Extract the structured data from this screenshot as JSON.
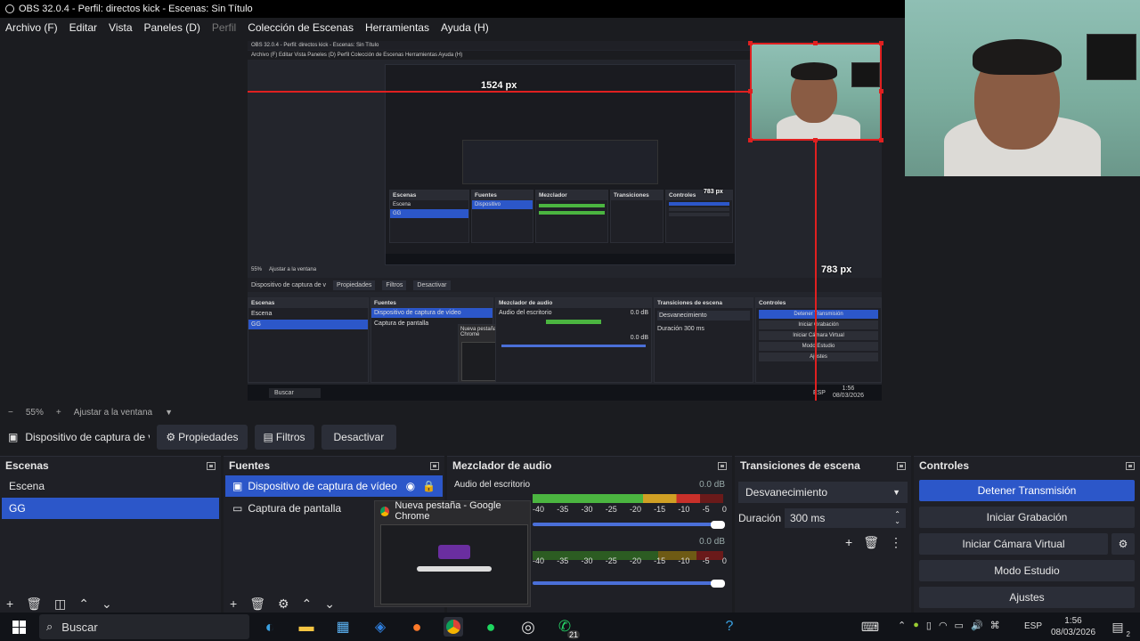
{
  "window": {
    "title": "OBS 32.0.4 - Perfil: directos kick - Escenas: Sin Título"
  },
  "menu": [
    {
      "label": "Archivo (F)",
      "disabled": false
    },
    {
      "label": "Editar",
      "disabled": false
    },
    {
      "label": "Vista",
      "disabled": false
    },
    {
      "label": "Paneles (D)",
      "disabled": false
    },
    {
      "label": "Perfil",
      "disabled": true
    },
    {
      "label": "Colección de Escenas",
      "disabled": false
    },
    {
      "label": "Herramientas",
      "disabled": false
    },
    {
      "label": "Ayuda (H)",
      "disabled": false
    }
  ],
  "preview": {
    "width_label": "1524 px",
    "height_label": "783 px",
    "height_label_inner": "783 px",
    "nested_title": "OBS 32.0.4 - Perfil: directos kick - Escenas: Sin Título",
    "nested_menu": "Archivo (F)   Editar   Vista   Paneles (D)   Perfil   Colección de Escenas   Herramientas   Ayuda (H)",
    "nested_zoom": "55%",
    "nested_fit": "Ajustar a la ventana",
    "nested_source": "Dispositivo de captura de v",
    "nested_props": "Propiedades",
    "nested_filters": "Filtros",
    "nested_deactivate": "Desactivar",
    "nested_scenes_title": "Escenas",
    "nested_scene_1": "Escena",
    "nested_scene_2": "GG",
    "nested_sources_title": "Fuentes",
    "nested_source_1": "Dispositivo de captura de vídeo",
    "nested_source_2": "Captura de pantalla",
    "nested_chrome": "Nueva pestaña - Google Chrome",
    "nested_mixer_title": "Mezclador de audio",
    "nested_mixer_ch": "Audio del escritorio",
    "nested_mixer_db1": "0.0 dB",
    "nested_mixer_db2": "0.0 dB",
    "nested_trans_title": "Transiciones de escena",
    "nested_trans_value": "Desvanecimiento",
    "nested_duration": "Duración",
    "nested_duration_value": "300 ms",
    "nested_controls_title": "Controles",
    "nested_ctrl_1": "Detener Transmisión",
    "nested_ctrl_2": "Iniciar Grabación",
    "nested_ctrl_3": "Iniciar Cámara Virtual",
    "nested_ctrl_4": "Modo Estudio",
    "nested_ctrl_5": "Ajustes",
    "nested_search": "Buscar",
    "nested_time": "1:56",
    "nested_date": "08/03/2026",
    "nested_lang": "ESP"
  },
  "zoom": {
    "minus": "−",
    "value": "55%",
    "plus": "+",
    "fit": "Ajustar a la ventana"
  },
  "source_toolbar": {
    "source_name": "Dispositivo de captura de v",
    "properties": "Propiedades",
    "filters": "Filtros",
    "deactivate": "Desactivar"
  },
  "scenes": {
    "title": "Escenas",
    "items": [
      {
        "label": "Escena",
        "selected": false
      },
      {
        "label": "GG",
        "selected": true
      }
    ]
  },
  "sources": {
    "title": "Fuentes",
    "items": [
      {
        "label": "Dispositivo de captura de vídeo",
        "selected": true
      },
      {
        "label": "Captura de pantalla",
        "selected": false
      }
    ]
  },
  "mixer": {
    "title": "Mezclador de audio",
    "channel_1": {
      "name": "Audio del escritorio",
      "db": "0.0 dB",
      "level": 0.88
    },
    "channel_2": {
      "db": "0.0 dB",
      "level": 0.0
    },
    "scale": [
      "-40",
      "-35",
      "-30",
      "-25",
      "-20",
      "-15",
      "-10",
      "-5",
      "0"
    ]
  },
  "transitions": {
    "title": "Transiciones de escena",
    "value": "Desvanecimiento",
    "duration_label": "Duración",
    "duration_value": "300 ms"
  },
  "controls": {
    "title": "Controles",
    "buttons": [
      "Detener Transmisión",
      "Iniciar Grabación",
      "Iniciar Cámara Virtual",
      "Modo Estudio",
      "Ajustes"
    ]
  },
  "chrome_tooltip": {
    "title": "Nueva pestaña - Google Chrome"
  },
  "taskbar": {
    "search": "Buscar",
    "whatsapp_badge": "21",
    "lang": "ESP",
    "time": "1:56",
    "date": "08/03/2026",
    "notification_count": "2"
  },
  "colors": {
    "accent": "#2c57c9",
    "bg": "#1b1c20",
    "panel": "#1f2026",
    "guide": "#e02020"
  }
}
